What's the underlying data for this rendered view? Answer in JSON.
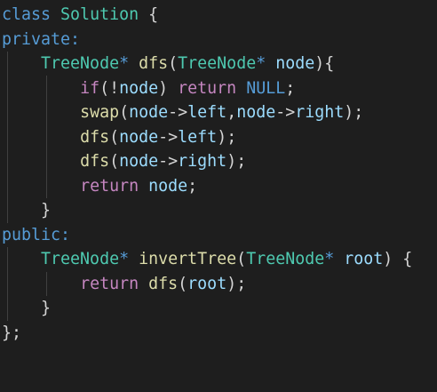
{
  "code": {
    "lines": [
      [
        {
          "t": "class",
          "c": "kw"
        },
        {
          "t": " "
        },
        {
          "t": "Solution",
          "c": "ty"
        },
        {
          "t": " {"
        }
      ],
      [
        {
          "t": "private:",
          "c": "kw"
        }
      ],
      [
        {
          "t": "    "
        },
        {
          "t": "TreeNode",
          "c": "ty"
        },
        {
          "t": "* ",
          "c": "kw"
        },
        {
          "t": "dfs",
          "c": "fn"
        },
        {
          "t": "("
        },
        {
          "t": "TreeNode",
          "c": "ty"
        },
        {
          "t": "* ",
          "c": "kw"
        },
        {
          "t": "node",
          "c": "var"
        },
        {
          "t": "){"
        }
      ],
      [
        {
          "t": "        "
        },
        {
          "t": "if",
          "c": "kw2"
        },
        {
          "t": "(!"
        },
        {
          "t": "node",
          "c": "var"
        },
        {
          "t": ") "
        },
        {
          "t": "return",
          "c": "kw2"
        },
        {
          "t": " "
        },
        {
          "t": "NULL",
          "c": "kw"
        },
        {
          "t": ";"
        }
      ],
      [
        {
          "t": "        "
        },
        {
          "t": "swap",
          "c": "fn"
        },
        {
          "t": "("
        },
        {
          "t": "node",
          "c": "var"
        },
        {
          "t": "->"
        },
        {
          "t": "left",
          "c": "var"
        },
        {
          "t": ","
        },
        {
          "t": "node",
          "c": "var"
        },
        {
          "t": "->"
        },
        {
          "t": "right",
          "c": "var"
        },
        {
          "t": ");"
        }
      ],
      [
        {
          "t": "        "
        },
        {
          "t": "dfs",
          "c": "fn"
        },
        {
          "t": "("
        },
        {
          "t": "node",
          "c": "var"
        },
        {
          "t": "->"
        },
        {
          "t": "left",
          "c": "var"
        },
        {
          "t": ");"
        }
      ],
      [
        {
          "t": "        "
        },
        {
          "t": "dfs",
          "c": "fn"
        },
        {
          "t": "("
        },
        {
          "t": "node",
          "c": "var"
        },
        {
          "t": "->"
        },
        {
          "t": "right",
          "c": "var"
        },
        {
          "t": ");"
        }
      ],
      [
        {
          "t": "        "
        },
        {
          "t": "return",
          "c": "kw2"
        },
        {
          "t": " "
        },
        {
          "t": "node",
          "c": "var"
        },
        {
          "t": ";"
        }
      ],
      [
        {
          "t": "    }"
        }
      ],
      [
        {
          "t": "public:",
          "c": "kw"
        }
      ],
      [
        {
          "t": "    "
        },
        {
          "t": "TreeNode",
          "c": "ty"
        },
        {
          "t": "* ",
          "c": "kw"
        },
        {
          "t": "invertTree",
          "c": "fn"
        },
        {
          "t": "("
        },
        {
          "t": "TreeNode",
          "c": "ty"
        },
        {
          "t": "* ",
          "c": "kw"
        },
        {
          "t": "root",
          "c": "var"
        },
        {
          "t": ") {"
        }
      ],
      [
        {
          "t": "        "
        },
        {
          "t": "return",
          "c": "kw2"
        },
        {
          "t": " "
        },
        {
          "t": "dfs",
          "c": "fn"
        },
        {
          "t": "("
        },
        {
          "t": "root",
          "c": "var"
        },
        {
          "t": ");"
        }
      ],
      [
        {
          "t": "    }"
        }
      ],
      [
        {
          "t": "};"
        }
      ]
    ]
  },
  "theme": {
    "background": "#1e1e1e",
    "keyword": "#569cd6",
    "control": "#c586c0",
    "type": "#4ec9b0",
    "function": "#dcdcaa",
    "variable": "#9cdcfe",
    "text": "#d4d4d4"
  }
}
